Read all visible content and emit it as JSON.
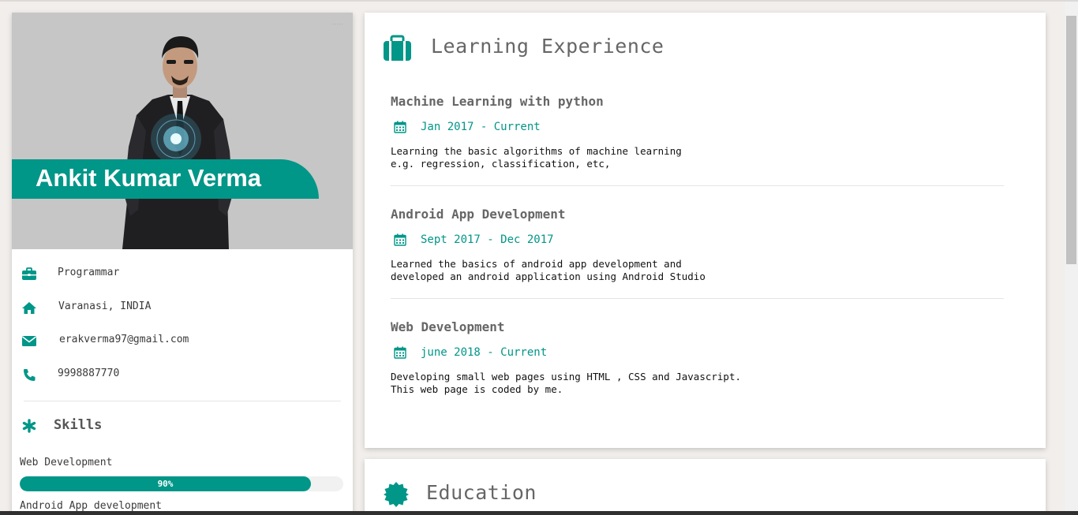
{
  "profile": {
    "name": "Ankit Kumar Verma",
    "photo_mark": "·····",
    "occupation": "Programmar",
    "location": "Varanasi, INDIA",
    "email": "erakverma97@gmail.com",
    "phone": "9998887770"
  },
  "skills": {
    "heading": "Skills",
    "items": [
      {
        "label": "Web Development",
        "percent": 90,
        "percent_label": "90%"
      },
      {
        "label": "Android App development"
      }
    ]
  },
  "experience": {
    "heading": "Learning Experience",
    "entries": [
      {
        "title": "Machine Learning with python",
        "date": "Jan 2017 - Current",
        "description": "Learning the basic algorithms of machine learning\ne.g. regression, classification, etc,"
      },
      {
        "title": "Android App Development",
        "date": "Sept 2017 - Dec 2017",
        "description": "Learned the basics of android app development and\ndeveloped an android application using Android Studio"
      },
      {
        "title": "Web Development",
        "date": "june 2018 - Current",
        "description": "Developing small web pages using HTML , CSS and Javascript.\nThis web page is coded by me."
      }
    ]
  },
  "education": {
    "heading": "Education"
  },
  "colors": {
    "accent": "#009688",
    "background": "#f1eeeb",
    "card": "#ffffff"
  },
  "icons": {
    "occupation": "briefcase-icon",
    "location": "home-icon",
    "email": "envelope-icon",
    "phone": "phone-icon",
    "skills": "asterisk-icon",
    "experience": "suitcase-icon",
    "date": "calendar-icon",
    "education": "badge-icon"
  }
}
